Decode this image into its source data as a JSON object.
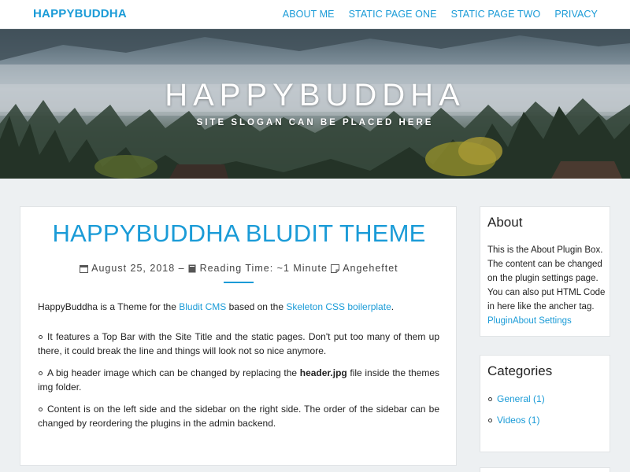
{
  "topbar": {
    "site_title": "HAPPYBUDDHA",
    "nav": [
      "ABOUT ME",
      "STATIC PAGE ONE",
      "STATIC PAGE TWO",
      "PRIVACY"
    ]
  },
  "hero": {
    "title": "HAPPYBUDDHA",
    "slogan": "SITE SLOGAN CAN BE PLACED HERE"
  },
  "post": {
    "title": "HAPPYBUDDHA BLUDIT THEME",
    "date": "August 25, 2018",
    "separator": "–",
    "reading_time": "Reading Time: ~1 Minute",
    "pinned": "Angeheftet",
    "intro_prefix": "HappyBuddha is a Theme for the ",
    "intro_link1": "Bludit CMS",
    "intro_middle": " based on the ",
    "intro_link2": "Skeleton CSS boilerplate",
    "intro_suffix": ".",
    "feature1": "It features a Top Bar with the Site Title and the static pages. Don't put too many of them up there, it could break the line and things will look not so nice anymore.",
    "feature2_prefix": "A big header image which can be changed by replacing the ",
    "feature2_bold": "header.jpg",
    "feature2_suffix": " file inside the themes img folder.",
    "feature3": "Content is on the left side and the sidebar on the right side. The order of the sidebar can be changed by reordering the plugins in the admin backend."
  },
  "sidebar": {
    "about": {
      "heading": "About",
      "text": "This is the About Plugin Box. The content can be changed on the plugin settings page. You can also put HTML Code in here like the ancher tag.",
      "link": "PluginAbout Settings"
    },
    "categories": {
      "heading": "Categories",
      "items": [
        "General (1)",
        "Videos (1)"
      ]
    }
  },
  "colors": {
    "accent": "#1a9bd7",
    "page_background": "#edf0f2"
  },
  "icons": [
    "calendar-icon",
    "book-icon",
    "pin-note-icon"
  ]
}
